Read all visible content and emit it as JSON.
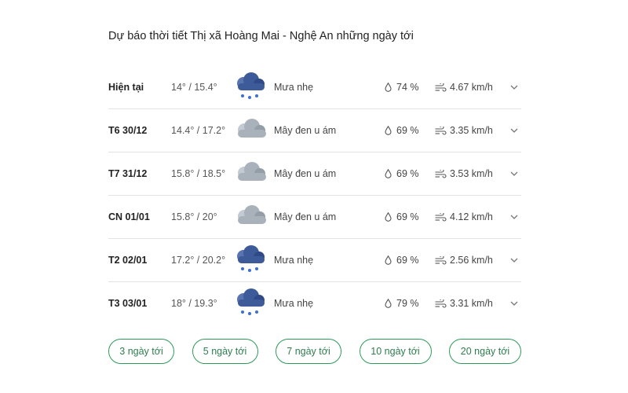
{
  "page": {
    "title": "Dự báo thời tiết Thị xã Hoàng Mai - Nghệ An những ngày tới"
  },
  "forecast": [
    {
      "day": "Hiện tại",
      "temp": "14° / 15.4°",
      "icon": "rain-cloud-icon",
      "condition": "Mưa nhẹ",
      "humidity": "74 %",
      "wind": "4.67 km/h"
    },
    {
      "day": "T6 30/12",
      "temp": "14.4° / 17.2°",
      "icon": "overcast-cloud-icon",
      "condition": "Mây đen u ám",
      "humidity": "69 %",
      "wind": "3.35 km/h"
    },
    {
      "day": "T7 31/12",
      "temp": "15.8° / 18.5°",
      "icon": "overcast-cloud-icon",
      "condition": "Mây đen u ám",
      "humidity": "69 %",
      "wind": "3.53 km/h"
    },
    {
      "day": "CN 01/01",
      "temp": "15.8° / 20°",
      "icon": "overcast-cloud-icon",
      "condition": "Mây đen u ám",
      "humidity": "69 %",
      "wind": "4.12 km/h"
    },
    {
      "day": "T2 02/01",
      "temp": "17.2° / 20.2°",
      "icon": "rain-cloud-icon",
      "condition": "Mưa nhẹ",
      "humidity": "69 %",
      "wind": "2.56 km/h"
    },
    {
      "day": "T3 03/01",
      "temp": "18° / 19.3°",
      "icon": "rain-cloud-icon",
      "condition": "Mưa nhẹ",
      "humidity": "79 %",
      "wind": "3.31 km/h"
    }
  ],
  "range_buttons": [
    "3 ngày tới",
    "5 ngày tới",
    "7 ngày tới",
    "10 ngày tới",
    "20 ngày tới"
  ],
  "colors": {
    "accent": "#2e9a5a",
    "rain_cloud": "#3d5a99",
    "overcast_cloud": "#a9b2bb",
    "rain_drop": "#3b6fd1"
  }
}
